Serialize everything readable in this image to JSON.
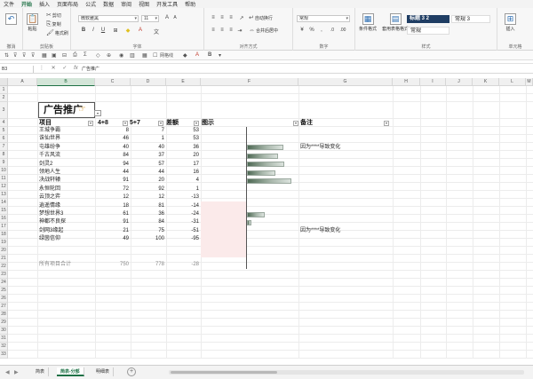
{
  "menu": [
    "文件",
    "开始",
    "插入",
    "页面布局",
    "公式",
    "数据",
    "审阅",
    "视图",
    "开发工具",
    "帮助"
  ],
  "active_menu": "开始",
  "ribbon": {
    "clipboard": {
      "paste": "粘贴",
      "cut": "剪切",
      "copy": "复制",
      "format_painter": "格式刷",
      "label": "剪贴板"
    },
    "font": {
      "name": "微软雅黑",
      "size": "11",
      "label": "字体",
      "bold": "B",
      "italic": "I",
      "underline": "U"
    },
    "align": {
      "wrap": "自动换行",
      "merge": "合并后居中",
      "label": "对齐方式"
    },
    "number": {
      "format": "常规",
      "label": "数字",
      "percent": "%",
      "comma": ","
    },
    "styles": {
      "cond": "条件格式",
      "table": "套用表格格式",
      "style_a": "标题 3 2",
      "style_b": "常规 3",
      "style_c": "常规",
      "label": "样式"
    },
    "cells": {
      "insert": "插入",
      "label": "单元格"
    },
    "group_undo": "撤消"
  },
  "qat": {
    "gridlines": "网格线"
  },
  "formula_bar": {
    "name_box": "B3",
    "content": "广告推广"
  },
  "columns": [
    "A",
    "B",
    "C",
    "D",
    "E",
    "F",
    "G",
    "H",
    "I",
    "J",
    "K",
    "L",
    "M"
  ],
  "rows": [
    "1",
    "2",
    "3",
    "4",
    "5",
    "6",
    "7",
    "8",
    "9",
    "10",
    "11",
    "12",
    "13",
    "14",
    "15",
    "16",
    "17",
    "18",
    "19",
    "20",
    "21",
    "22",
    "23",
    "24",
    "25",
    "26",
    "27",
    "28",
    "29",
    "30",
    "31",
    "32",
    "33",
    "34",
    "35"
  ],
  "sheet": {
    "title": "广告推广",
    "headers": {
      "item": "项目",
      "c": "4+8",
      "d": "5+7",
      "diff": "差额",
      "chart": "图示",
      "note": "备注"
    },
    "data": [
      {
        "name": "王城争霸",
        "c": "8",
        "d": "7",
        "diff": "53",
        "bar": 0.0,
        "note": ""
      },
      {
        "name": "诛仙世界",
        "c": "46",
        "d": "1",
        "diff": "53",
        "bar": 0.0,
        "note": ""
      },
      {
        "name": "屯雄纷争",
        "c": "40",
        "d": "40",
        "diff": "36",
        "bar": 0.0,
        "note": "因为****导致变化"
      },
      {
        "name": "千古风流",
        "c": "84",
        "d": "37",
        "diff": "20",
        "bar": 0.0,
        "note": ""
      },
      {
        "name": "剑灵2",
        "c": "94",
        "d": "57",
        "diff": "17",
        "bar": 0.0,
        "note": ""
      },
      {
        "name": "领地人生",
        "c": "44",
        "d": "44",
        "diff": "16",
        "bar": 0.0,
        "note": ""
      },
      {
        "name": "决战轩辕",
        "c": "91",
        "d": "20",
        "diff": "4",
        "bar": 0.0,
        "note": ""
      },
      {
        "name": "永恒轮回",
        "c": "72",
        "d": "92",
        "diff": "1",
        "bar": 0.0,
        "note": ""
      },
      {
        "name": "云顶之弈",
        "c": "12",
        "d": "12",
        "diff": "-13",
        "bar": 0.0,
        "note": ""
      },
      {
        "name": "逍遥情缘",
        "c": "18",
        "d": "81",
        "diff": "-14",
        "bar": 0.0,
        "note": ""
      },
      {
        "name": "梦想世界3",
        "c": "61",
        "d": "36",
        "diff": "-24",
        "bar": 0.0,
        "note": ""
      },
      {
        "name": "神都不良探",
        "c": "91",
        "d": "84",
        "diff": "-31",
        "bar": 0.0,
        "note": ""
      },
      {
        "name": "剑网3缘起",
        "c": "21",
        "d": "75",
        "diff": "-51",
        "bar": 0.0,
        "note": "因为****导致变化"
      },
      {
        "name": "绿茵信仰",
        "c": "49",
        "d": "100",
        "diff": "-95",
        "bar": 0.0,
        "note": ""
      }
    ],
    "total": {
      "name": "所有项目合计",
      "c": "750",
      "d": "778",
      "diff": "-28"
    }
  },
  "tabs": [
    "简表",
    "简表-分部",
    "明细表"
  ],
  "active_tab": "简表-分部",
  "bar_widths": [
    0.02,
    0.02,
    0.78,
    0.67,
    0.8,
    0.62,
    0.96,
    0.02,
    0.0,
    0.0,
    0.38,
    0.1,
    0.0,
    0.0
  ]
}
